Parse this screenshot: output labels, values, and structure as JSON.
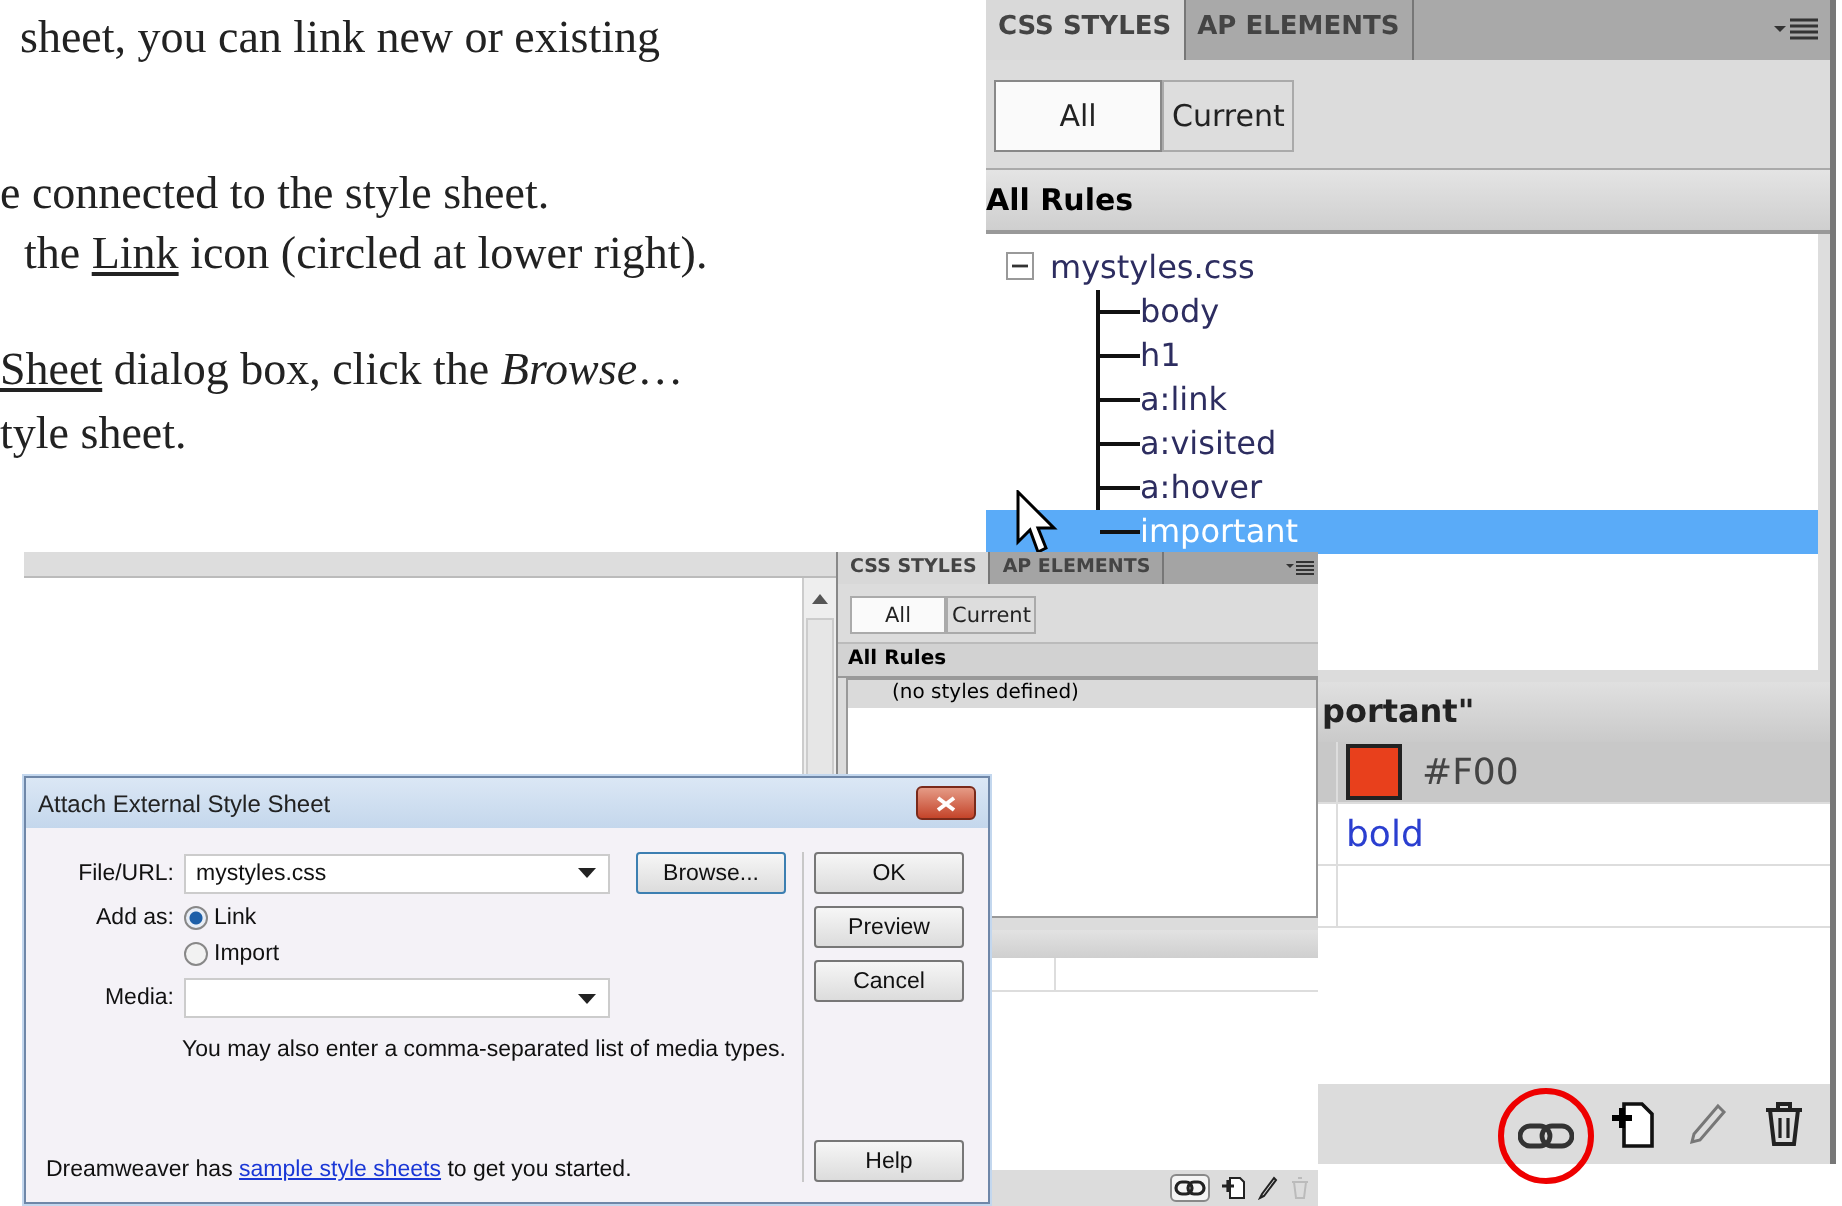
{
  "document_text": {
    "lines": [
      [
        {
          "text": "sheet, you can link new or existing",
          "underlined": false
        }
      ],
      [
        {
          "text": "e connected to the style sheet.",
          "underlined": false
        }
      ],
      [
        {
          "text": "the ",
          "underlined": false
        },
        {
          "text": "Link",
          "underlined": true
        },
        {
          "text": " icon (circled at lower right).",
          "underlined": false
        }
      ],
      [
        {
          "text": "Sheet",
          "underlined": true
        },
        {
          "text": " dialog box, click the *Browse*…",
          "underlined": false
        }
      ],
      [
        {
          "text": "tyle sheet.",
          "underlined": false
        }
      ]
    ]
  },
  "styles_panel": {
    "tabs": [
      {
        "label": "CSS STYLES",
        "selected": true
      },
      {
        "label": "AP ELEMENTS",
        "selected": false
      }
    ],
    "view_buttons": [
      {
        "label": "All",
        "selected": true
      },
      {
        "label": "Current",
        "selected": false
      }
    ],
    "section_header": "All Rules",
    "tree": {
      "label": "mystyles.css",
      "expanded": true,
      "children": [
        {
          "label": "body",
          "selected": false
        },
        {
          "label": "h1",
          "selected": false
        },
        {
          "label": "a:link",
          "selected": false
        },
        {
          "label": "a:visited",
          "selected": false
        },
        {
          "label": "a:hover",
          "selected": false
        },
        {
          "label": "important",
          "selected": true
        }
      ]
    },
    "properties_header": "portant\"",
    "properties": [
      {
        "kind": "color",
        "value": "#F00",
        "color": "#e8401c"
      },
      {
        "kind": "text",
        "value": "bold"
      }
    ],
    "toolbar": [
      {
        "kind": "link",
        "circled": true
      },
      {
        "kind": "new",
        "circled": false
      },
      {
        "kind": "edit",
        "circled": false
      },
      {
        "kind": "delete",
        "circled": false
      }
    ]
  },
  "small_panel": {
    "tabs": [
      {
        "label": "CSS STYLES",
        "selected": true
      },
      {
        "label": "AP ELEMENTS",
        "selected": false
      }
    ],
    "view_buttons": [
      {
        "label": "All",
        "selected": true
      },
      {
        "label": "Current",
        "selected": false
      }
    ],
    "section_header": "All Rules",
    "rules": [
      "(no styles defined)"
    ],
    "toolbar": [
      {
        "kind": "link",
        "disabled": false
      },
      {
        "kind": "new",
        "disabled": false
      },
      {
        "kind": "edit",
        "disabled": false
      },
      {
        "kind": "delete",
        "disabled": true
      }
    ]
  },
  "dialog": {
    "title": "Attach External Style Sheet",
    "file_label": "File/URL:",
    "file_value": "mystyles.css",
    "browse_button": "Browse...",
    "add_as_label": "Add as:",
    "add_as_options": [
      {
        "label": "Link",
        "selected": true
      },
      {
        "label": "Import",
        "selected": false
      }
    ],
    "media_label": "Media:",
    "media_hint": "You may also enter a comma-separated list of media types.",
    "footer": {
      "before": "Dreamweaver has ",
      "link": "sample style sheets",
      "after": " to get you started."
    },
    "buttons": [
      "OK",
      "Preview",
      "Cancel"
    ],
    "help_button": "Help"
  }
}
